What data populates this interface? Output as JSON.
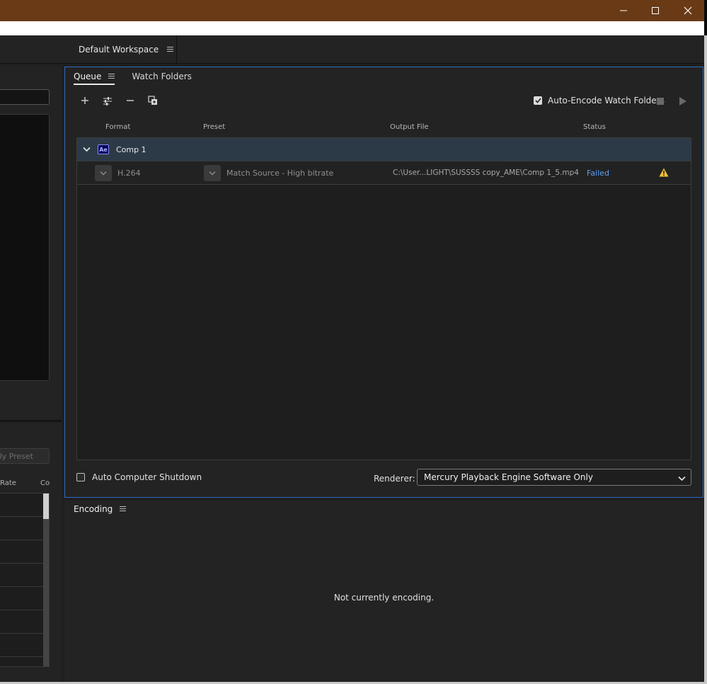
{
  "window": {
    "min_icon": "minimize-icon",
    "max_icon": "maximize-icon",
    "close_icon": "close-icon",
    "titlebar_color": "#6a3a17"
  },
  "workspace": {
    "tab_label": "Default Workspace"
  },
  "left_panel": {
    "apply_preset_label": "Apply Preset",
    "columns": [
      "Rate",
      "Co"
    ]
  },
  "queue": {
    "tabs": [
      {
        "label": "Queue",
        "active": true
      },
      {
        "label": "Watch Folders",
        "active": false
      }
    ],
    "toolbar": {
      "add_icon": "plus-icon",
      "settings_icon": "settings-sliders-icon",
      "remove_icon": "minus-icon",
      "duplicate_icon": "duplicate-icon",
      "auto_encode_label": "Auto-Encode Watch Folders",
      "auto_encode_checked": true
    },
    "columns": {
      "format": "Format",
      "preset": "Preset",
      "output": "Output File",
      "status": "Status"
    },
    "items": [
      {
        "name": "Comp 1",
        "app_badge": "Ae",
        "outputs": [
          {
            "format": "H.264",
            "preset": "Match Source - High bitrate",
            "output_file": "C:\\User...LIGHT\\SUSSSS copy_AME\\Comp 1_5.mp4",
            "status": "Failed",
            "status_color": "#5aa0f0"
          }
        ]
      }
    ],
    "footer": {
      "auto_shutdown_label": "Auto Computer Shutdown",
      "auto_shutdown_checked": false,
      "renderer_label": "Renderer:",
      "renderer_value": "Mercury Playback Engine Software Only"
    }
  },
  "encoding": {
    "tab_label": "Encoding",
    "message": "Not currently encoding."
  },
  "colors": {
    "accent_border": "#2c6cc0",
    "warning": "#f2c233"
  }
}
